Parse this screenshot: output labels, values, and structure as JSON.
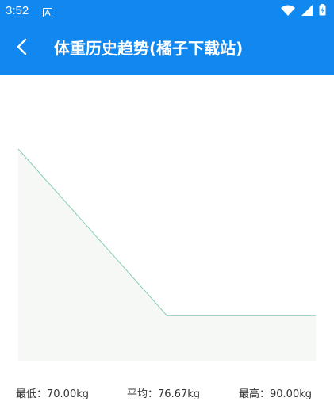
{
  "status_bar": {
    "time": "3:52",
    "icons": [
      "notification-a-icon",
      "wifi-icon",
      "signal-icon",
      "battery-charging-icon"
    ]
  },
  "app_bar": {
    "title": "体重历史趋势(橘子下载站)",
    "back_icon": "chevron-left-icon"
  },
  "colors": {
    "primary": "#1187f0",
    "chart_line": "#84ceb1",
    "chart_fill": "#f6f8f6"
  },
  "chart_data": {
    "type": "area",
    "x": [
      0,
      1,
      2
    ],
    "values": [
      90.0,
      70.0,
      70.0
    ],
    "ylim": [
      64.5,
      90.0
    ]
  },
  "stats": {
    "min": "最低：70.00kg",
    "avg": "平均：76.67kg",
    "max": "最高：90.00kg"
  }
}
